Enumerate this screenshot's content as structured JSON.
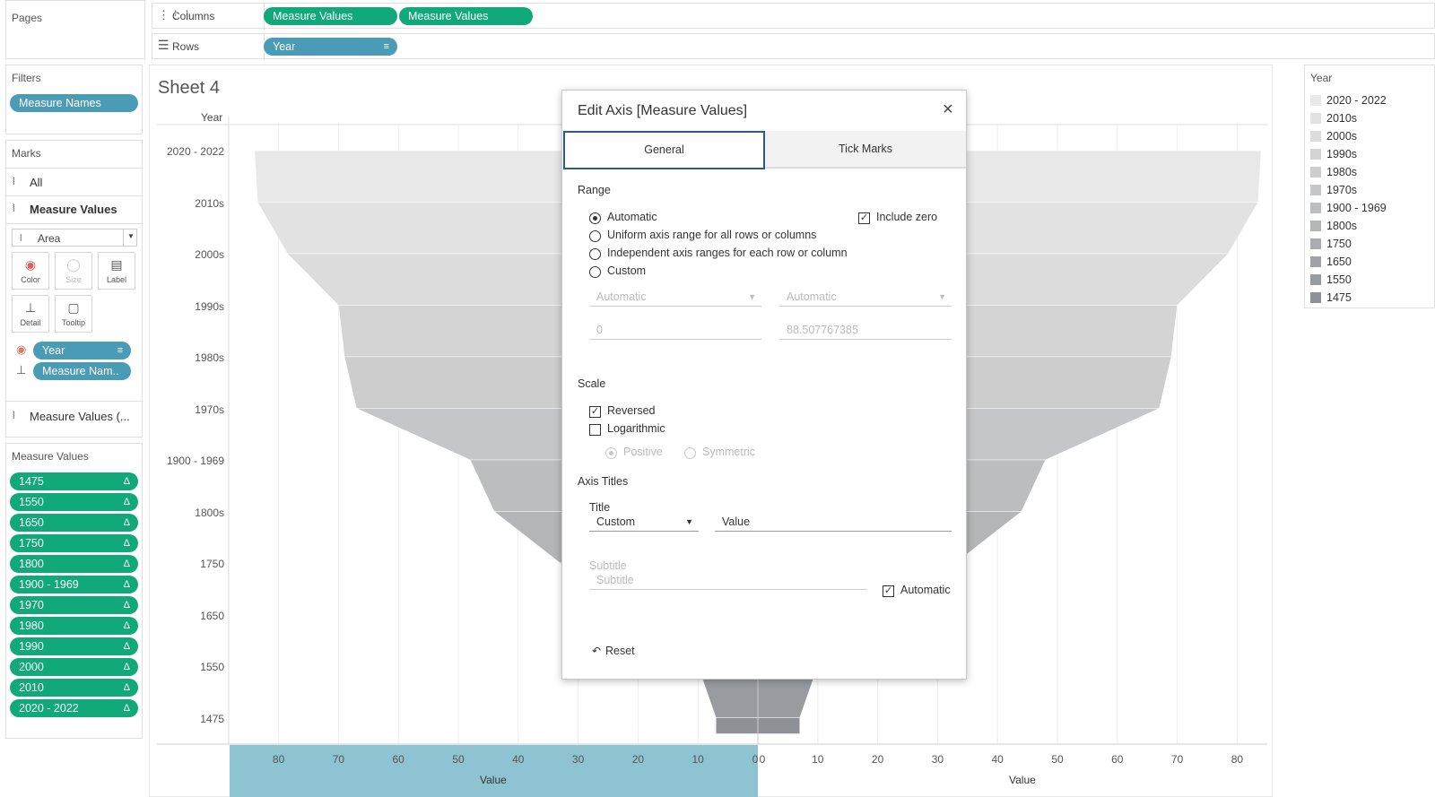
{
  "shelves": {
    "pages_label": "Pages",
    "columns_label": "Columns",
    "rows_label": "Rows",
    "columns_pills": [
      "Measure Values",
      "Measure Values"
    ],
    "rows_pill": "Year"
  },
  "filters": {
    "title": "Filters",
    "pill": "Measure Names"
  },
  "marks": {
    "title": "Marks",
    "all_label": "All",
    "measure_values_label": "Measure Values",
    "mark_type": "Area",
    "buttons": {
      "color": "Color",
      "size": "Size",
      "label": "Label",
      "detail": "Detail",
      "tooltip": "Tooltip"
    },
    "year_pill": "Year",
    "measure_names_pill": "Measure Nam..",
    "measure_values_section": "Measure Values (..."
  },
  "measure_values_card": {
    "title": "Measure Values",
    "items": [
      "1475",
      "1550",
      "1650",
      "1750",
      "1800",
      "1900 - 1969",
      "1970",
      "1980",
      "1990",
      "2000",
      "2010",
      "2020 - 2022"
    ]
  },
  "sheet": {
    "title": "Sheet 4",
    "row_header": "Year",
    "x_axis_title_left": "Value",
    "x_axis_title_right": "Value",
    "left_ticks": [
      "80",
      "70",
      "60",
      "50",
      "40",
      "30",
      "20",
      "10",
      "0"
    ],
    "right_ticks": [
      "0",
      "10",
      "20",
      "30",
      "40",
      "50",
      "60",
      "70",
      "80"
    ]
  },
  "chart_data": {
    "type": "area",
    "categories": [
      "2020 - 2022",
      "2010s",
      "2000s",
      "1990s",
      "1980s",
      "1970s",
      "1900 - 1969",
      "1800s",
      "1750",
      "1650",
      "1550",
      "1475"
    ],
    "ylabel": "Year",
    "xlabel": "Value",
    "left_xlim": [
      88.5,
      0
    ],
    "right_xlim": [
      0,
      88.5
    ],
    "values_left": [
      84,
      83.5,
      78.5,
      70,
      69,
      67,
      48,
      44,
      33,
      22,
      10,
      7
    ],
    "values_right": [
      84,
      83.5,
      78.5,
      70,
      69,
      67,
      48,
      44,
      33,
      22,
      10,
      7
    ]
  },
  "legend": {
    "title": "Year",
    "items": [
      {
        "label": "2020 - 2022",
        "color": "#e8e8e8"
      },
      {
        "label": "2010s",
        "color": "#e2e2e2"
      },
      {
        "label": "2000s",
        "color": "#dcdcdc"
      },
      {
        "label": "1990s",
        "color": "#d4d4d5"
      },
      {
        "label": "1980s",
        "color": "#cdcdce"
      },
      {
        "label": "1970s",
        "color": "#c5c6c7"
      },
      {
        "label": "1900 - 1969",
        "color": "#bcbdbf"
      },
      {
        "label": "1800s",
        "color": "#b3b5b7"
      },
      {
        "label": "1750",
        "color": "#aaacaf"
      },
      {
        "label": "1650",
        "color": "#a1a3a7"
      },
      {
        "label": "1550",
        "color": "#989b9f"
      },
      {
        "label": "1475",
        "color": "#8e9297"
      }
    ]
  },
  "dialog": {
    "title": "Edit Axis [Measure Values]",
    "tabs": [
      "General",
      "Tick Marks"
    ],
    "range_title": "Range",
    "range_options": [
      "Automatic",
      "Uniform axis range for all rows or columns",
      "Independent axis ranges for each row or column",
      "Custom"
    ],
    "include_zero": "Include zero",
    "range_start_select": "Automatic",
    "range_end_select": "Automatic",
    "range_start_value": "0",
    "range_end_value": "88.507767385",
    "scale_title": "Scale",
    "reversed": "Reversed",
    "logarithmic": "Logarithmic",
    "positive": "Positive",
    "symmetric": "Symmetric",
    "axis_titles_title": "Axis Titles",
    "title_label": "Title",
    "title_mode": "Custom",
    "title_value": "Value",
    "subtitle_label": "Subtitle",
    "subtitle_placeholder": "Subtitle",
    "automatic": "Automatic",
    "reset": "Reset"
  }
}
